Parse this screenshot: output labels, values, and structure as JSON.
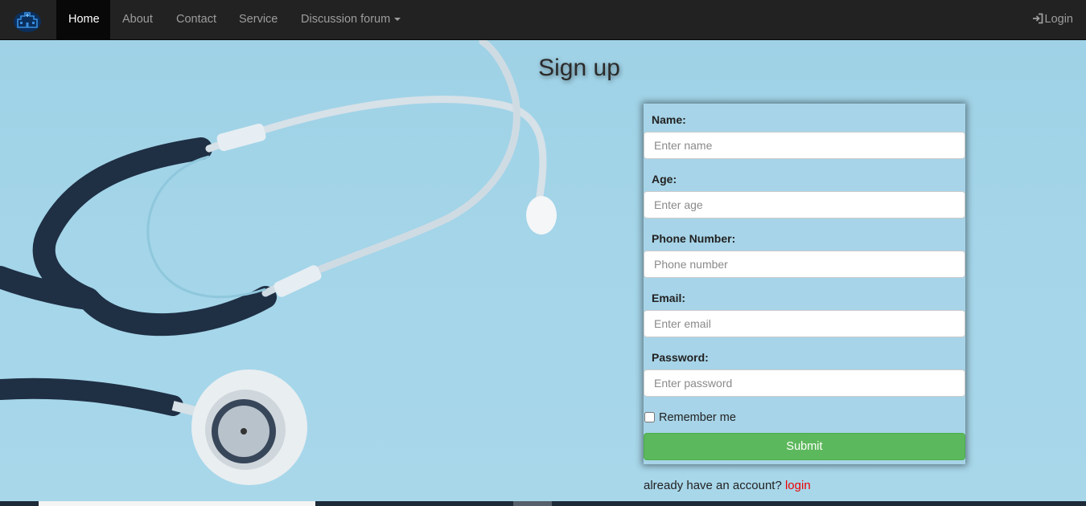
{
  "nav": {
    "brand_icon": "hospital-logo-icon",
    "items": [
      {
        "label": "Home",
        "active": true
      },
      {
        "label": "About",
        "active": false
      },
      {
        "label": "Contact",
        "active": false
      },
      {
        "label": "Service",
        "active": false
      },
      {
        "label": "Discussion forum",
        "active": false,
        "dropdown": true
      }
    ],
    "login_label": "Login",
    "login_icon": "log-in-icon"
  },
  "page": {
    "title": "Sign up"
  },
  "form": {
    "name_label": "Name:",
    "name_placeholder": "Enter name",
    "age_label": "Age:",
    "age_placeholder": "Enter age",
    "phone_label": "Phone Number:",
    "phone_placeholder": "Phone number",
    "email_label": "Email:",
    "email_placeholder": "Enter email",
    "password_label": "Password:",
    "password_placeholder": "Enter password",
    "remember_label": "Remember me",
    "submit_label": "Submit"
  },
  "account": {
    "prompt": "already have an account?",
    "login_link": "login"
  },
  "colors": {
    "navbar": "#222222",
    "submit": "#5cb85c",
    "link": "#ee0000",
    "background": "#a5d5e8"
  }
}
